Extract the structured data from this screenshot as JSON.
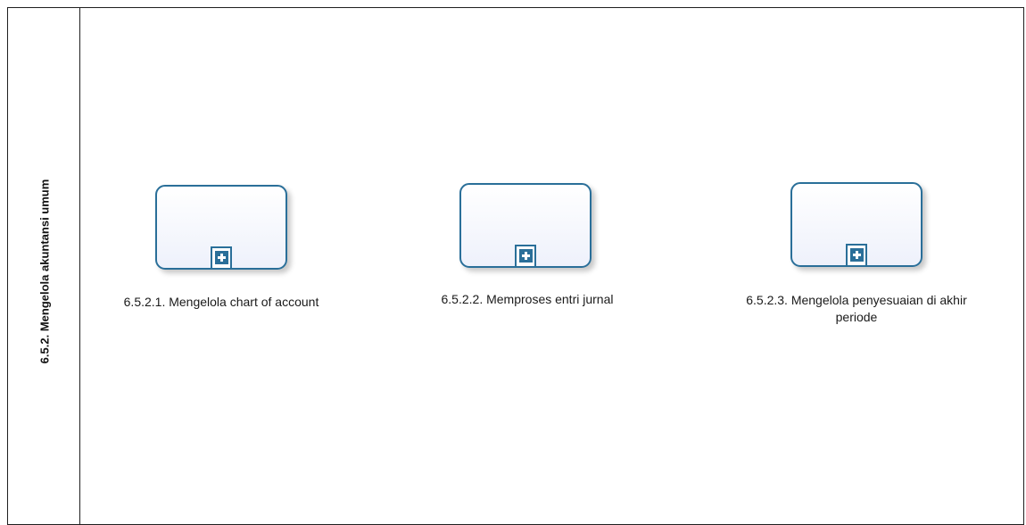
{
  "lane": {
    "title": "6.5.2. Mengelola akuntansi umum"
  },
  "tasks": [
    {
      "label": "6.5.2.1. Mengelola chart of account",
      "marker": "collapsed-subprocess-plus-icon"
    },
    {
      "label": "6.5.2.2. Memproses entri jurnal",
      "marker": "collapsed-subprocess-plus-icon"
    },
    {
      "label": "6.5.2.3. Mengelola penyesuaian di akhir periode",
      "marker": "collapsed-subprocess-plus-icon"
    }
  ],
  "colors": {
    "task_border": "#2a6f99",
    "task_fill_bottom": "#eef1fb",
    "pool_border": "#1f1f1f"
  }
}
